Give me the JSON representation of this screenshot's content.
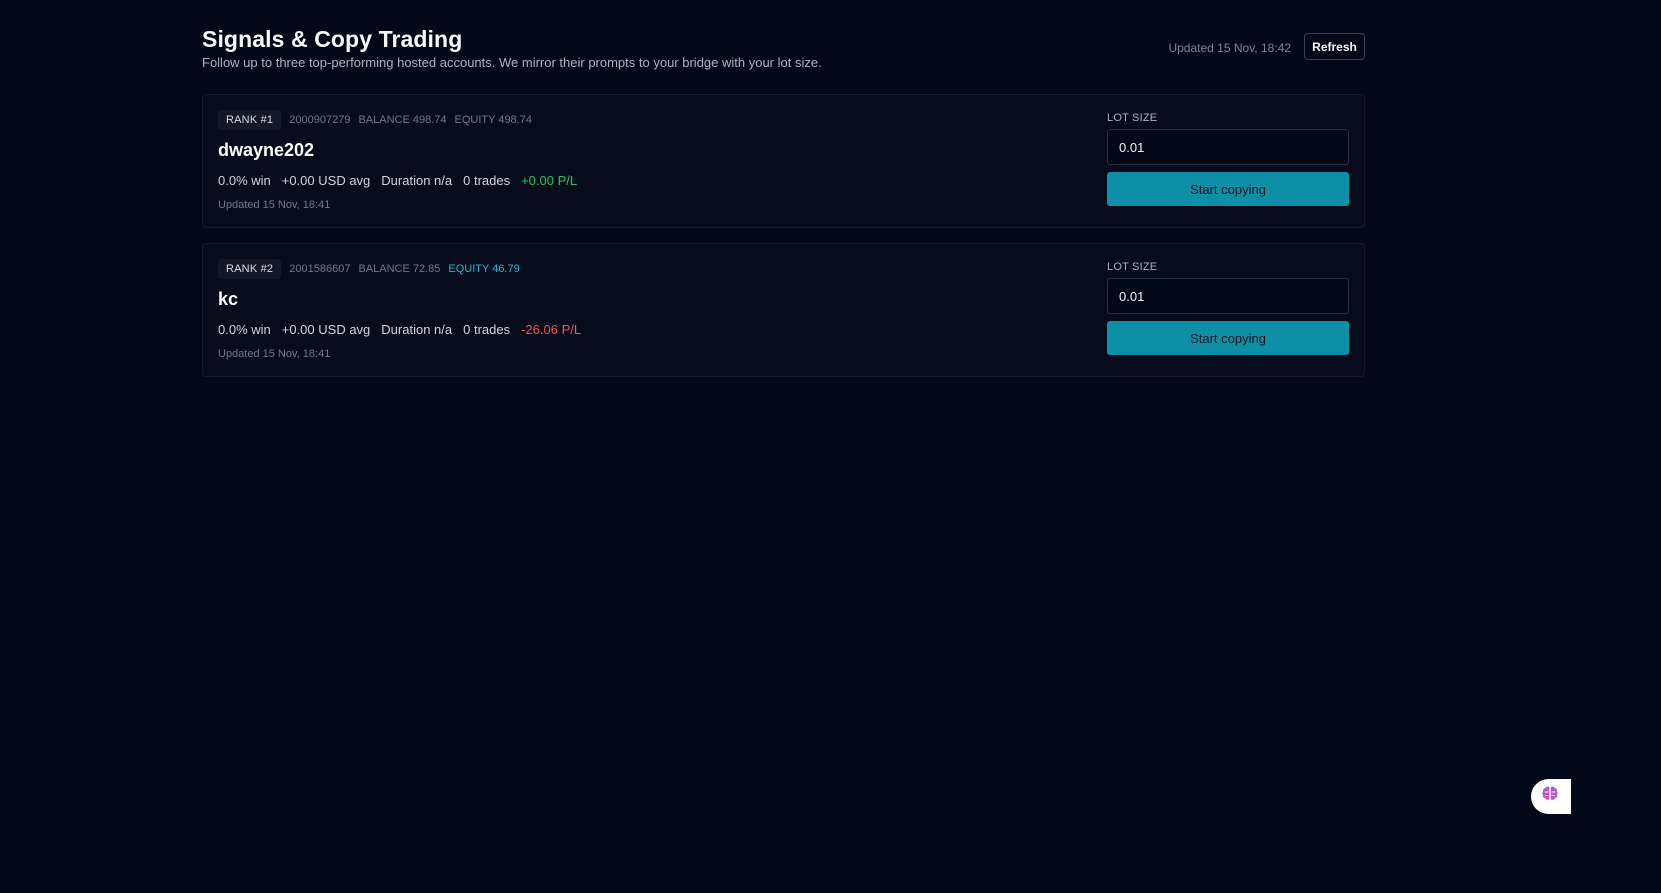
{
  "header": {
    "title": "Signals & Copy Trading",
    "subtitle": "Follow up to three top-performing hosted accounts. We mirror their prompts to your bridge with your lot size.",
    "updated": "Updated 15 Nov, 18:42",
    "refresh_label": "Refresh"
  },
  "accounts": [
    {
      "rank": "RANK #1",
      "account_id": "2000907279",
      "balance": "BALANCE 498.74",
      "equity": "EQUITY 498.74",
      "name": "dwayne202",
      "win_rate": "0.0% win",
      "avg": "+0.00 USD avg",
      "duration": "Duration n/a",
      "trades": "0 trades",
      "pl": "+0.00 P/L",
      "updated": "Updated 15 Nov, 18:41",
      "lot_label": "LOT SIZE",
      "lot_value": "0.01",
      "button_label": "Start copying"
    },
    {
      "rank": "RANK #2",
      "account_id": "2001586607",
      "balance": "BALANCE 72.85",
      "equity": "EQUITY 46.79",
      "name": "kc",
      "win_rate": "0.0% win",
      "avg": "+0.00 USD avg",
      "duration": "Duration n/a",
      "trades": "0 trades",
      "pl": "-26.06 P/L",
      "updated": "Updated 15 Nov, 18:41",
      "lot_label": "LOT SIZE",
      "lot_value": "0.01",
      "button_label": "Start copying"
    }
  ],
  "colors": {
    "background": "#030819",
    "card": "#070c1d",
    "accent": "#0e8fa8",
    "positive": "#22c55e",
    "negative": "#f05454",
    "equity_highlight": "#22b8d8"
  },
  "floating": {
    "icon": "brain-icon"
  }
}
